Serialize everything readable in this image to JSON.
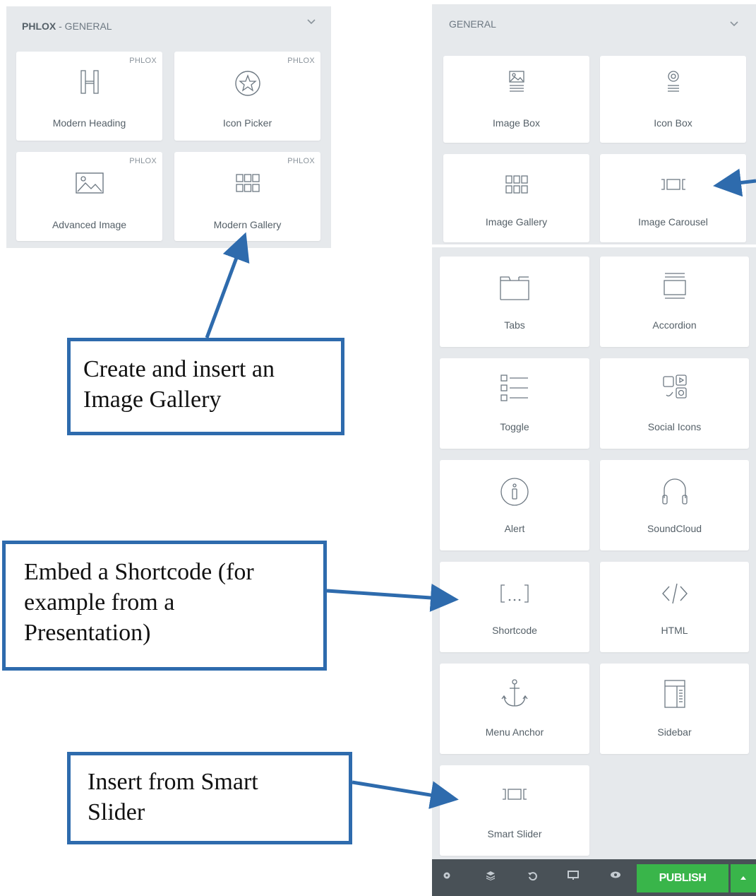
{
  "left_panel": {
    "title_bold": "PHLOX",
    "title_rest": " - GENERAL",
    "widgets": [
      {
        "label": "Modern Heading",
        "badge": "PHLOX",
        "icon": "heading-icon"
      },
      {
        "label": "Icon Picker",
        "badge": "PHLOX",
        "icon": "star-circle-icon"
      },
      {
        "label": "Advanced Image",
        "badge": "PHLOX",
        "icon": "image-icon"
      },
      {
        "label": "Modern Gallery",
        "badge": "PHLOX",
        "icon": "grid-icon"
      }
    ]
  },
  "right_panel": {
    "title": "GENERAL",
    "widgets": [
      {
        "label": "Image Box",
        "icon": "image-box-icon"
      },
      {
        "label": "Icon Box",
        "icon": "icon-box-icon"
      },
      {
        "label": "Image Gallery",
        "icon": "grid-icon"
      },
      {
        "label": "Image Carousel",
        "icon": "carousel-icon"
      }
    ]
  },
  "widget_list": [
    {
      "label": "Tabs",
      "icon": "tabs-icon"
    },
    {
      "label": "Accordion",
      "icon": "accordion-icon"
    },
    {
      "label": "Toggle",
      "icon": "toggle-icon"
    },
    {
      "label": "Social Icons",
      "icon": "social-icons-icon"
    },
    {
      "label": "Alert",
      "icon": "info-icon"
    },
    {
      "label": "SoundCloud",
      "icon": "headphones-icon"
    },
    {
      "label": "Shortcode",
      "icon": "shortcode-icon"
    },
    {
      "label": "HTML",
      "icon": "code-icon"
    },
    {
      "label": "Menu Anchor",
      "icon": "anchor-icon"
    },
    {
      "label": "Sidebar",
      "icon": "sidebar-icon"
    },
    {
      "label": "Smart Slider",
      "icon": "slider-icon"
    }
  ],
  "callouts": {
    "gallery": [
      "Create and insert an",
      "Image Gallery"
    ],
    "shortcode": [
      "Embed a Shortcode (for",
      "example from a",
      "Presentation)"
    ],
    "slider": [
      "Insert from Smart",
      "Slider"
    ]
  },
  "toolbar": {
    "publish_label": "PUBLISH",
    "icons": [
      "gear-icon",
      "layers-icon",
      "history-icon",
      "responsive-icon",
      "preview-icon",
      "caret-up-icon"
    ]
  },
  "colors": {
    "panel_bg": "#e6e9ec",
    "callout_border": "#2e6bad",
    "toolbar_bg": "#495157",
    "publish_green": "#39b54a"
  }
}
